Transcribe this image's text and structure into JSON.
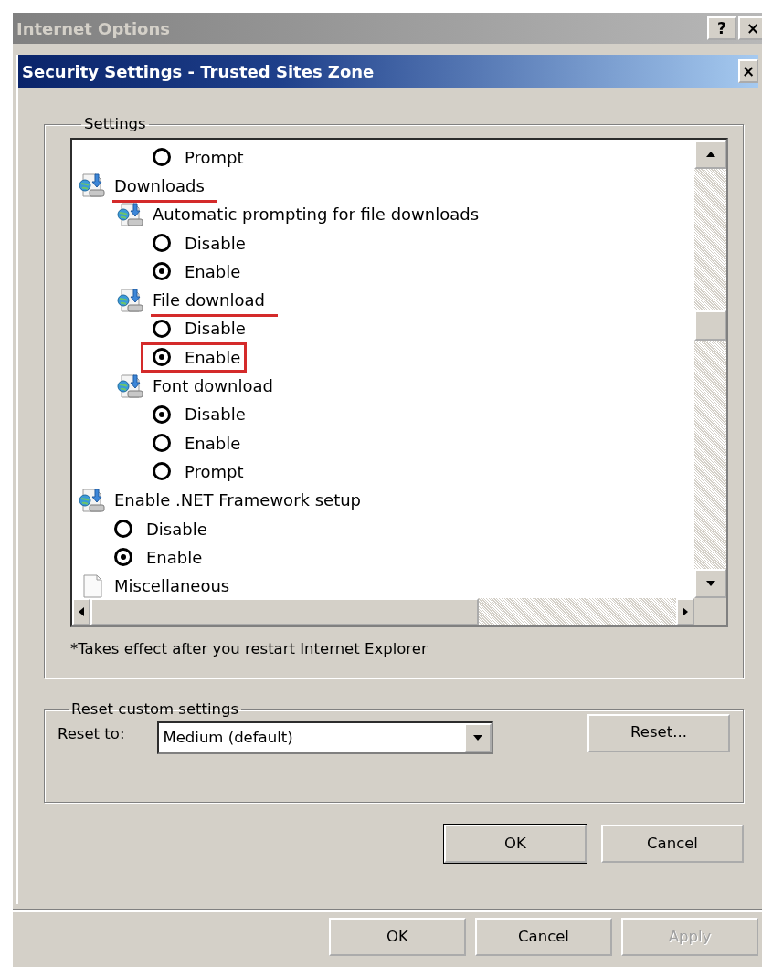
{
  "outer_window": {
    "title": "Internet Options",
    "help_button": "?",
    "close_button": "×"
  },
  "dialog": {
    "title": "Security Settings - Trusted Sites Zone",
    "close_button": "×",
    "settings": {
      "legend": "Settings",
      "items": [
        {
          "kind": "offscreen",
          "children": [
            {
              "kind": "offscreen",
              "children": [
                {
                  "kind": "radio",
                  "label": "Prompt",
                  "selected": false
                }
              ]
            }
          ]
        },
        {
          "kind": "setting",
          "label": "Downloads",
          "underlined": true,
          "children": [
            {
              "kind": "setting",
              "label": "Automatic prompting for file downloads",
              "children": [
                {
                  "kind": "radio",
                  "label": "Disable",
                  "selected": false
                },
                {
                  "kind": "radio",
                  "label": "Enable",
                  "selected": true
                }
              ]
            },
            {
              "kind": "setting",
              "label": "File download",
              "underlined": true,
              "children": [
                {
                  "kind": "radio",
                  "label": "Disable",
                  "selected": false
                },
                {
                  "kind": "radio",
                  "label": "Enable",
                  "selected": true,
                  "boxed": true
                }
              ]
            },
            {
              "kind": "setting",
              "label": "Font download",
              "children": [
                {
                  "kind": "radio",
                  "label": "Disable",
                  "selected": true
                },
                {
                  "kind": "radio",
                  "label": "Enable",
                  "selected": false
                },
                {
                  "kind": "radio",
                  "label": "Prompt",
                  "selected": false
                }
              ]
            }
          ]
        },
        {
          "kind": "setting",
          "label": "Enable .NET Framework setup",
          "children": [
            {
              "kind": "radio",
              "label": "Disable",
              "selected": false
            },
            {
              "kind": "radio",
              "label": "Enable",
              "selected": true
            }
          ]
        },
        {
          "kind": "heading",
          "label": "Miscellaneous"
        }
      ],
      "footnote": "*Takes effect after you restart Internet Explorer"
    },
    "reset": {
      "legend": "Reset custom settings",
      "label": "Reset to:",
      "value": "Medium (default)",
      "button": "Reset..."
    },
    "buttons": [
      {
        "label": "OK",
        "default": true
      },
      {
        "label": "Cancel",
        "default": false
      }
    ]
  },
  "outer_buttons": [
    {
      "label": "OK",
      "disabled": false
    },
    {
      "label": "Cancel",
      "disabled": false
    },
    {
      "label": "Apply",
      "disabled": true
    }
  ]
}
